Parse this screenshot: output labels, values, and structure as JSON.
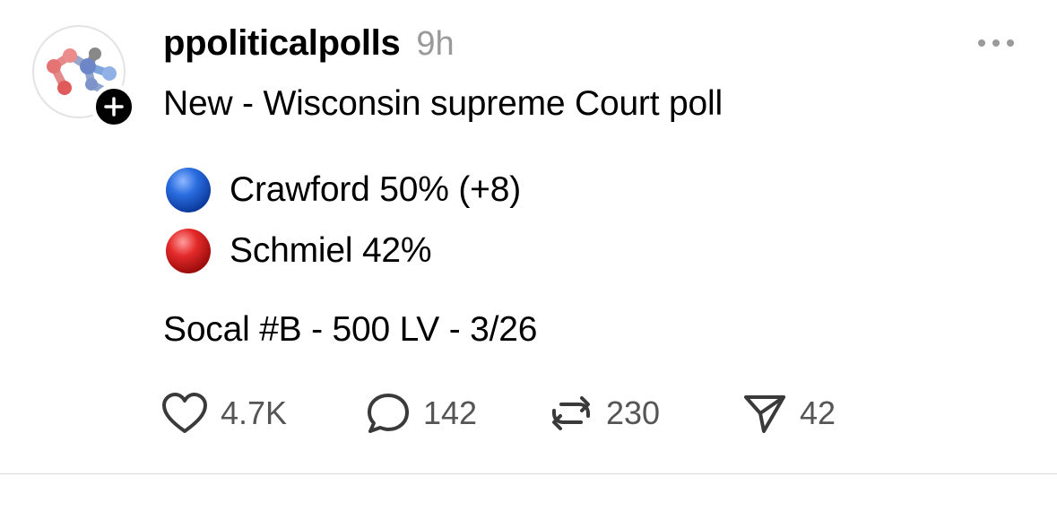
{
  "post": {
    "author": {
      "username": "ppoliticalpolls",
      "time_ago": "9h",
      "avatar_icon": "molecule-logo-icon",
      "follow_icon": "plus-icon"
    },
    "text": {
      "headline": "New - Wisconsin supreme Court poll",
      "options": [
        {
          "marker": "blue-circle",
          "color": "#1f5fd6",
          "text": "Crawford 50% (+8)"
        },
        {
          "marker": "red-circle",
          "color": "#d81d1d",
          "text": "Schmiel 42%"
        }
      ],
      "source": "Socal #B - 500 LV - 3/26"
    },
    "actions": {
      "like_count": "4.7K",
      "comment_count": "142",
      "repost_count": "230",
      "share_count": "42"
    },
    "menu_icon": "more-options-icon"
  }
}
